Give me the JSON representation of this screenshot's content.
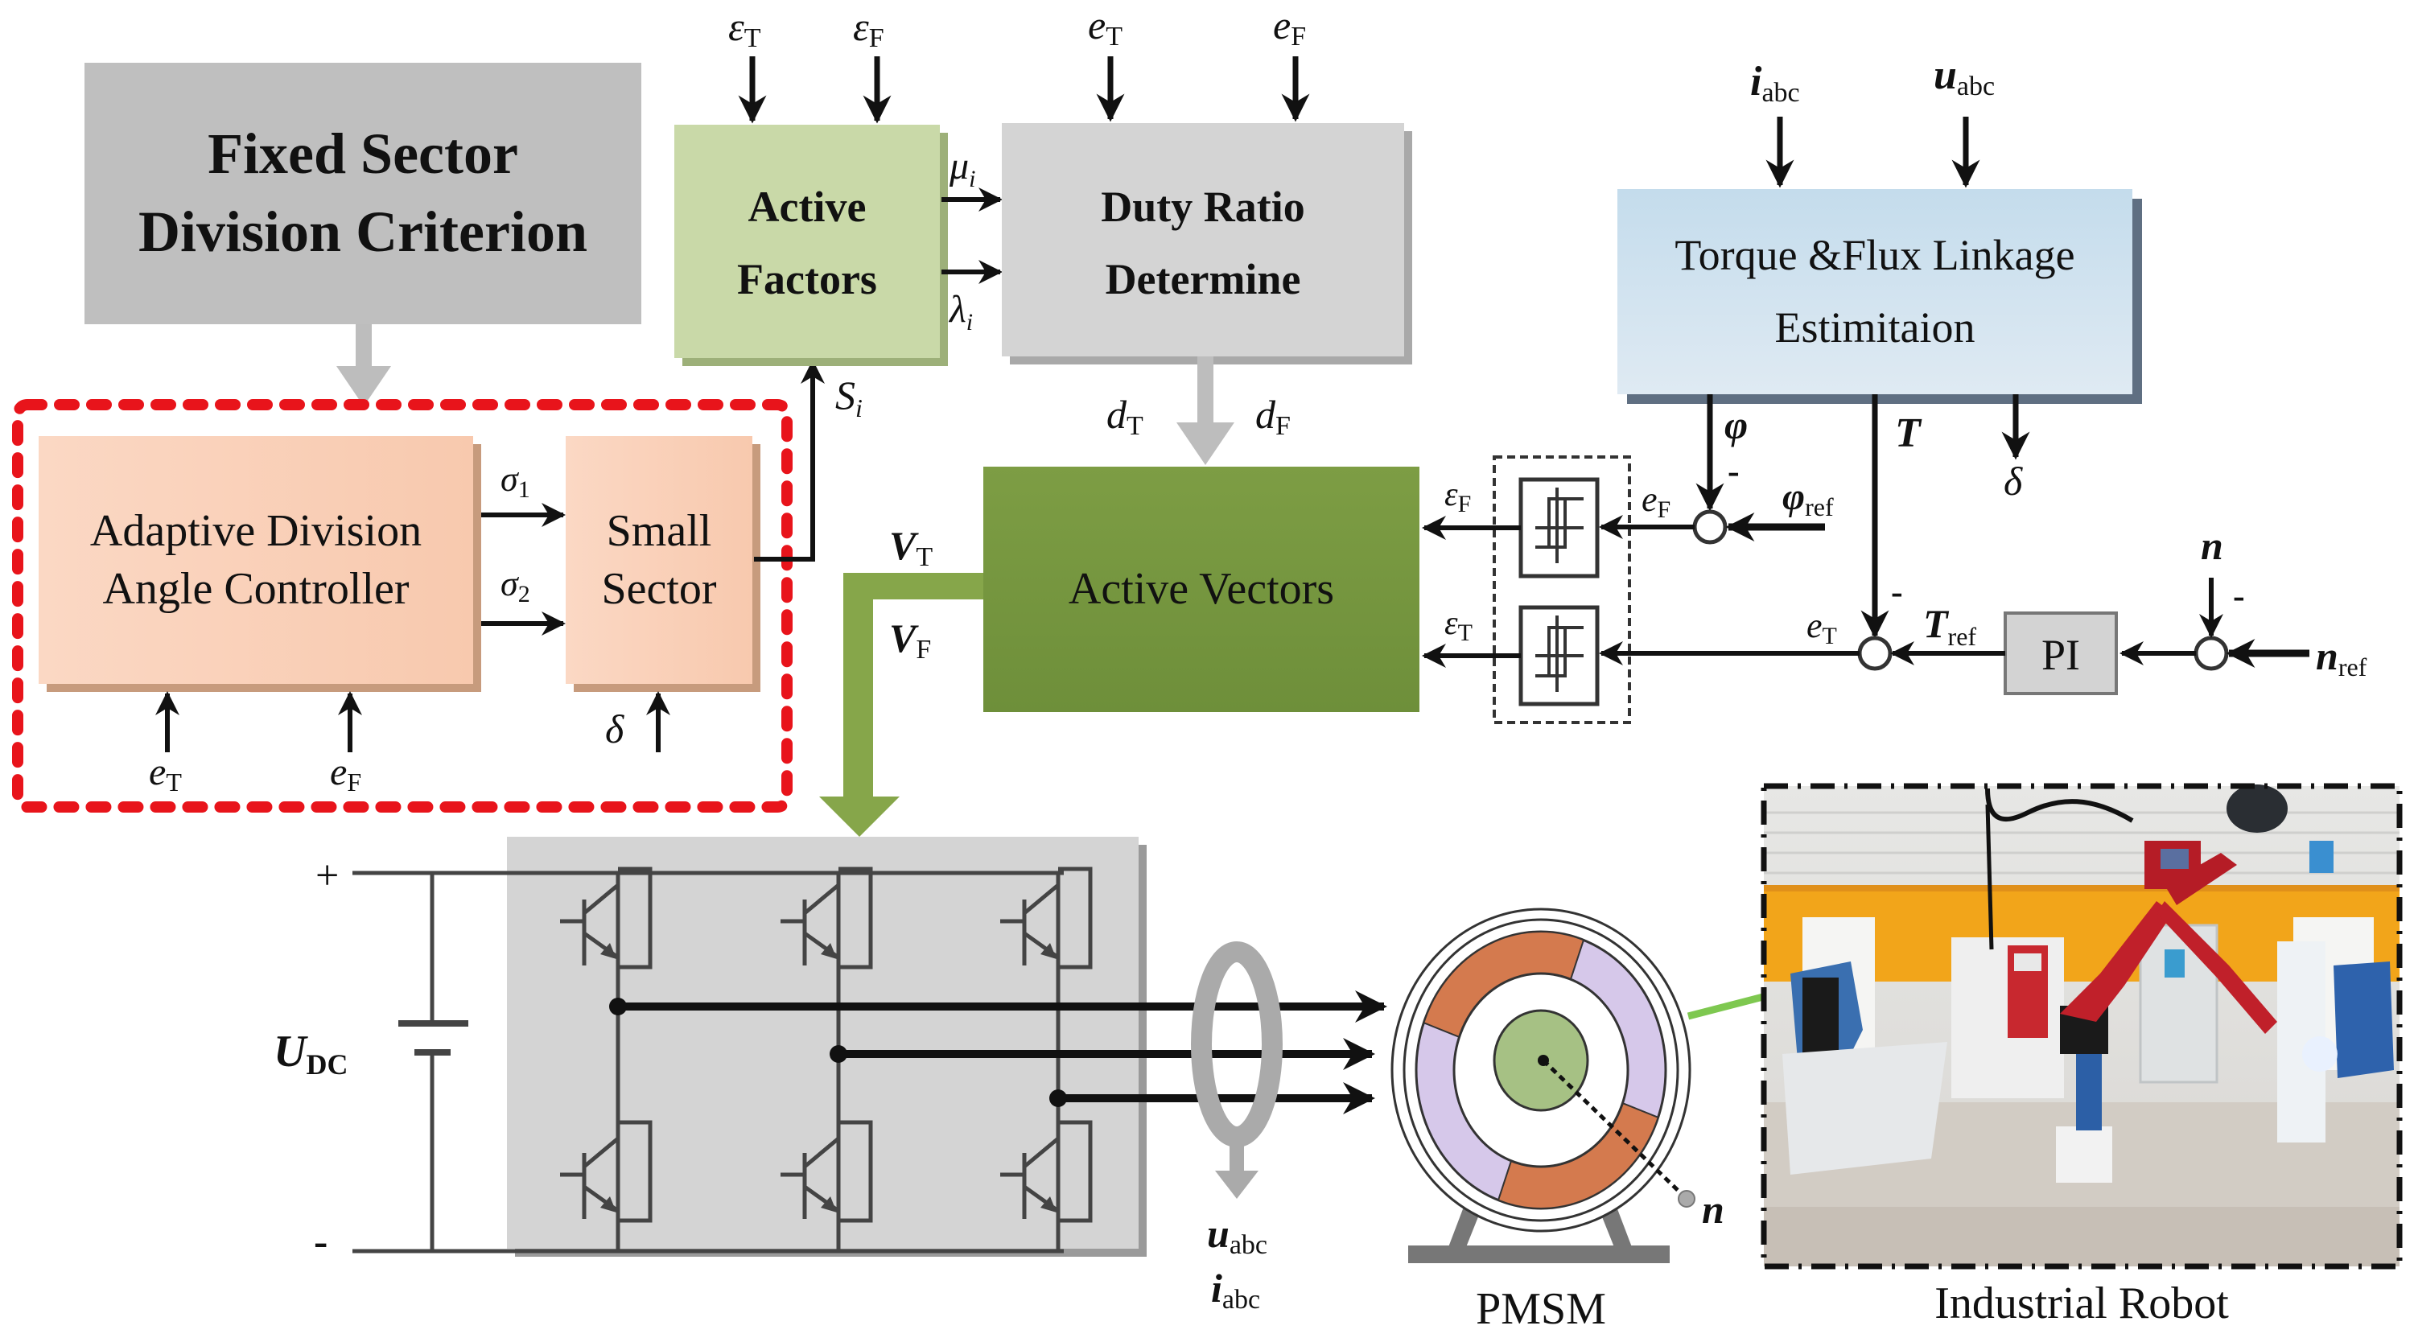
{
  "blocks": {
    "fixed_sector": {
      "line1": "Fixed Sector",
      "line2": "Division Criterion",
      "color": "#bfbfbf"
    },
    "active_factors": {
      "line1": "Active",
      "line2": "Factors",
      "color": "#c9d9a8"
    },
    "duty_ratio": {
      "line1": "Duty Ratio",
      "line2": "Determine",
      "color": "#d3d3d3"
    },
    "torque_flux": {
      "line1": "Torque &Flux Linkage",
      "line2": "Estimitaion",
      "color": "#cfe2ee"
    },
    "adaptive": {
      "line1": "Adaptive Division",
      "line2": "Angle Controller",
      "color": "#f9d3bd"
    },
    "small_sector": {
      "line1": "Small",
      "line2": "Sector",
      "color": "#f9d3bd"
    },
    "active_vectors": {
      "label": "Active Vectors",
      "color": "#7a9b3e"
    },
    "pi": {
      "label": "PI",
      "color": "#d3d3d3"
    }
  },
  "signals": {
    "eps_T_top": {
      "base": "ε",
      "sub": "T"
    },
    "eps_F_top": {
      "base": "ε",
      "sub": "F"
    },
    "e_T_top": {
      "base": "e",
      "sub": "T"
    },
    "e_F_top": {
      "base": "e",
      "sub": "F"
    },
    "i_abc_top": {
      "base": "i",
      "sub": "abc"
    },
    "u_abc_top": {
      "base": "u",
      "sub": "abc"
    },
    "mu_i": {
      "base": "μ",
      "sub": "i"
    },
    "lambda_i": {
      "base": "λ",
      "sub": "i"
    },
    "S_i": {
      "base": "S",
      "sub": "i"
    },
    "d_T": {
      "base": "d",
      "sub": "T"
    },
    "d_F": {
      "base": "d",
      "sub": "F"
    },
    "sigma_1": {
      "base": "σ",
      "sub": "1"
    },
    "sigma_2": {
      "base": "σ",
      "sub": "2"
    },
    "e_T_bottom": {
      "base": "e",
      "sub": "T"
    },
    "e_F_bottom": {
      "base": "e",
      "sub": "F"
    },
    "delta_small": "δ",
    "phi": "φ",
    "T": "T",
    "delta_out": "δ",
    "eps_F_right": {
      "base": "ε",
      "sub": "F"
    },
    "eps_T_right": {
      "base": "ε",
      "sub": "T"
    },
    "e_F_right": {
      "base": "e",
      "sub": "F"
    },
    "e_T_right": {
      "base": "e",
      "sub": "T"
    },
    "phi_ref": {
      "base": "φ",
      "sub": "ref"
    },
    "T_ref": {
      "base": "T",
      "sub": "ref"
    },
    "n_top": "n",
    "n_ref": {
      "base": "n",
      "sub": "ref"
    },
    "V_T": {
      "base": "V",
      "sub": "T"
    },
    "V_F": {
      "base": "V",
      "sub": "F"
    },
    "minus": "-",
    "plus": "+",
    "U_DC": {
      "base": "U",
      "sub": "DC"
    },
    "u_abc_bottom": {
      "base": "u",
      "sub": "abc"
    },
    "i_abc_bottom": {
      "base": "i",
      "sub": "abc"
    },
    "n_motor": "n"
  },
  "captions": {
    "pmsm": "PMSM",
    "robot": "Industrial Robot"
  },
  "colors": {
    "red_dash": "#e8141b",
    "green_link": "#7ec850",
    "arrow_gray": "#bdbdbd",
    "motor_orange": "#d47a4e",
    "motor_lavender": "#d6c8ea",
    "motor_rotor": "#a6c184"
  }
}
